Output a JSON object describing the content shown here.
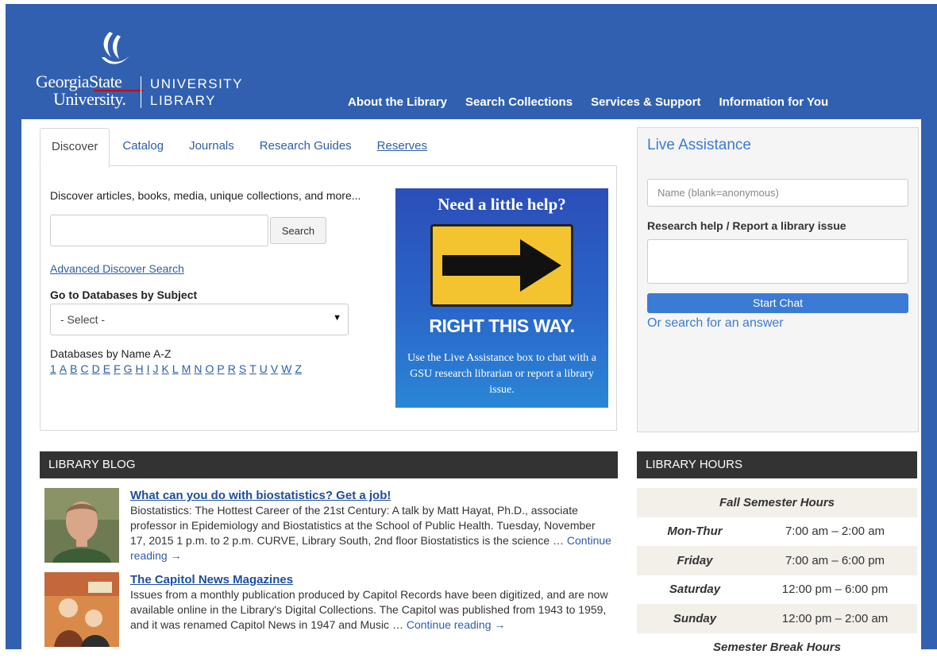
{
  "brand": {
    "name_line1": "GeorgiaState",
    "name_line2": "University.",
    "sub_line1": "UNIVERSITY",
    "sub_line2": "LIBRARY"
  },
  "nav": {
    "items": [
      "About the Library",
      "Search Collections",
      "Services & Support",
      "Information for You"
    ]
  },
  "tabs": [
    "Discover",
    "Catalog",
    "Journals",
    "Research Guides",
    "Reserves"
  ],
  "discover": {
    "label": "Discover articles, books, media, unique collections, and more...",
    "search_button": "Search",
    "advanced_link": "Advanced Discover Search",
    "subject_label": "Go to Databases by Subject",
    "subject_select": "- Select -",
    "az_label": "Databases by Name A-Z",
    "az_letters": [
      "1",
      "A",
      "B",
      "C",
      "D",
      "E",
      "F",
      "G",
      "H",
      "I",
      "J",
      "K",
      "L",
      "M",
      "N",
      "O",
      "P",
      "R",
      "S",
      "T",
      "U",
      "V",
      "W",
      "Z"
    ]
  },
  "promo": {
    "heading": "Need a little help?",
    "big": "RIGHT THIS WAY.",
    "body": "Use the Live Assistance box to chat with a GSU research librarian or report a library issue."
  },
  "live": {
    "title": "Live Assistance",
    "name_placeholder": "Name (blank=anonymous)",
    "research_label": "Research help / Report a library issue",
    "start_chat": "Start Chat",
    "or_search": "Or search for an answer"
  },
  "blog": {
    "title": "LIBRARY BLOG",
    "posts": [
      {
        "title": "What can you do with biostatistics? Get a job!",
        "text": "Biostatistics: The Hottest Career of the 21st Century: A talk by Matt Hayat, Ph.D., associate professor in Epidemiology and Biostatistics at the School of Public Health. Tuesday, November 17, 2015 1 p.m. to 2 p.m. CURVE, Library South, 2nd floor Biostatistics is the science …",
        "more": "Continue reading →"
      },
      {
        "title": "The Capitol News Magazines",
        "text": "Issues from a monthly publication produced by Capitol Records have been digitized, and are now available online in the Library's Digital Collections. The Capitol was published from 1943 to 1959, and it was renamed Capitol News in 1947 and Music …",
        "more": "Continue reading →"
      }
    ]
  },
  "hours": {
    "title": "LIBRARY HOURS",
    "heading": "Fall Semester Hours",
    "rows": [
      {
        "day": "Mon-Thur",
        "time": "7:00 am – 2:00 am"
      },
      {
        "day": "Friday",
        "time": "7:00 am – 6:00 pm"
      },
      {
        "day": "Saturday",
        "time": "12:00 pm – 6:00 pm"
      },
      {
        "day": "Sunday",
        "time": "12:00 pm – 2:00 am"
      }
    ],
    "next_heading": "Semester Break Hours"
  },
  "colors": {
    "header_blue": "#3160b0",
    "link_blue": "#2e5ea6",
    "accent_blue": "#3a7bd5",
    "bar_dark": "#333333",
    "sign_yellow": "#f4c430"
  }
}
